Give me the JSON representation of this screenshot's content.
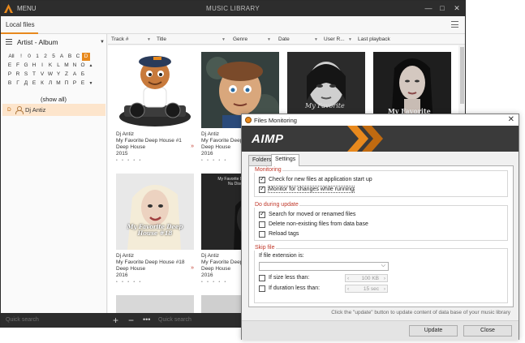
{
  "app": {
    "menu_label": "MENU",
    "title": "MUSIC LIBRARY"
  },
  "window_buttons": {
    "minimize": "—",
    "maximize": "□",
    "close": "✕"
  },
  "tabs": {
    "local_files": "Local files"
  },
  "left_panel": {
    "group_label": "Artist - Album",
    "alphabet_rows": [
      [
        "All",
        "!",
        "0",
        "1",
        "2",
        "5",
        "A",
        "B",
        "C",
        "D"
      ],
      [
        "E",
        "F",
        "G",
        "H",
        "I",
        "K",
        "L",
        "M",
        "N",
        "O"
      ],
      [
        "P",
        "R",
        "S",
        "T",
        "V",
        "W",
        "Y",
        "Z",
        "А",
        "Б"
      ],
      [
        "В",
        "Г",
        "Д",
        "Е",
        "К",
        "Л",
        "М",
        "П",
        "Р",
        "Е"
      ]
    ],
    "selected_letter": "D",
    "show_all": "(show all)",
    "artist_letter": "D",
    "artist_name": "Dj Antiz"
  },
  "columns": [
    "Track #",
    "Title",
    "Genre",
    "Date",
    "User R...",
    "Last playback"
  ],
  "albums": [
    {
      "artist": "Dj Antiz",
      "title": "My Favorite Deep House #1",
      "genre": "Deep House",
      "year": "2015",
      "rating": "• • • • •"
    },
    {
      "artist": "Dj Antiz",
      "title": "My Favorite Deep House #",
      "genre": "Deep House",
      "year": "2016",
      "rating": "• • • • •"
    },
    {
      "artist": "",
      "title": "",
      "genre": "",
      "year": "",
      "rating": "",
      "cover_text": "My Favorite"
    },
    {
      "artist": "",
      "title": "",
      "genre": "",
      "year": "",
      "rating": "",
      "cover_text": "My Favorite"
    },
    {
      "artist": "Dj Antiz",
      "title": "My Favorite Deep House #18",
      "genre": "Deep House",
      "year": "2016",
      "rating": "• • • • •",
      "cover_text": "My Favorite Deep House #18"
    },
    {
      "artist": "Dj Antiz",
      "title": "My Favorite Deep House #",
      "genre": "Deep House",
      "year": "2016",
      "rating": "• • • • •",
      "cover_text": "My Favorite Deep House Nu Disco #18"
    }
  ],
  "bottom_bar": {
    "quick_search_left": "Quick search",
    "add": "+",
    "remove": "−",
    "more": "•••",
    "quick_search_right": "Quick search"
  },
  "dialog": {
    "title": "Files Monitoring",
    "close": "✕",
    "banner": "AIMP",
    "tabs": [
      "Folders",
      "Settings"
    ],
    "active_tab": "Settings",
    "monitoring": {
      "title": "Monitoring",
      "check_new_files": "Check for new files at application start up",
      "check_new_files_checked": true,
      "monitor_changes": "Monitor for changes while running",
      "monitor_changes_checked": true
    },
    "during_update": {
      "title": "Do during update",
      "search_moved": "Search for moved or renamed files",
      "search_moved_checked": true,
      "delete_nonexisting": "Delete non-existing files from data base",
      "delete_nonexisting_checked": false,
      "reload_tags": "Reload tags",
      "reload_tags_checked": false
    },
    "skip_file": {
      "title": "Skip file",
      "extension_label": "If file extension is:",
      "extension_value": "",
      "size_label": "If size less than:",
      "size_value": "100 KB",
      "duration_label": "If duration less than:",
      "duration_value": "15 sec"
    },
    "hint": "Click the \"update\" button to update content of data base of your music library",
    "update_button": "Update",
    "close_button": "Close"
  },
  "colors": {
    "accent": "#e8891d",
    "titlebar": "#2d2d2d",
    "group_title": "#c0392b"
  }
}
